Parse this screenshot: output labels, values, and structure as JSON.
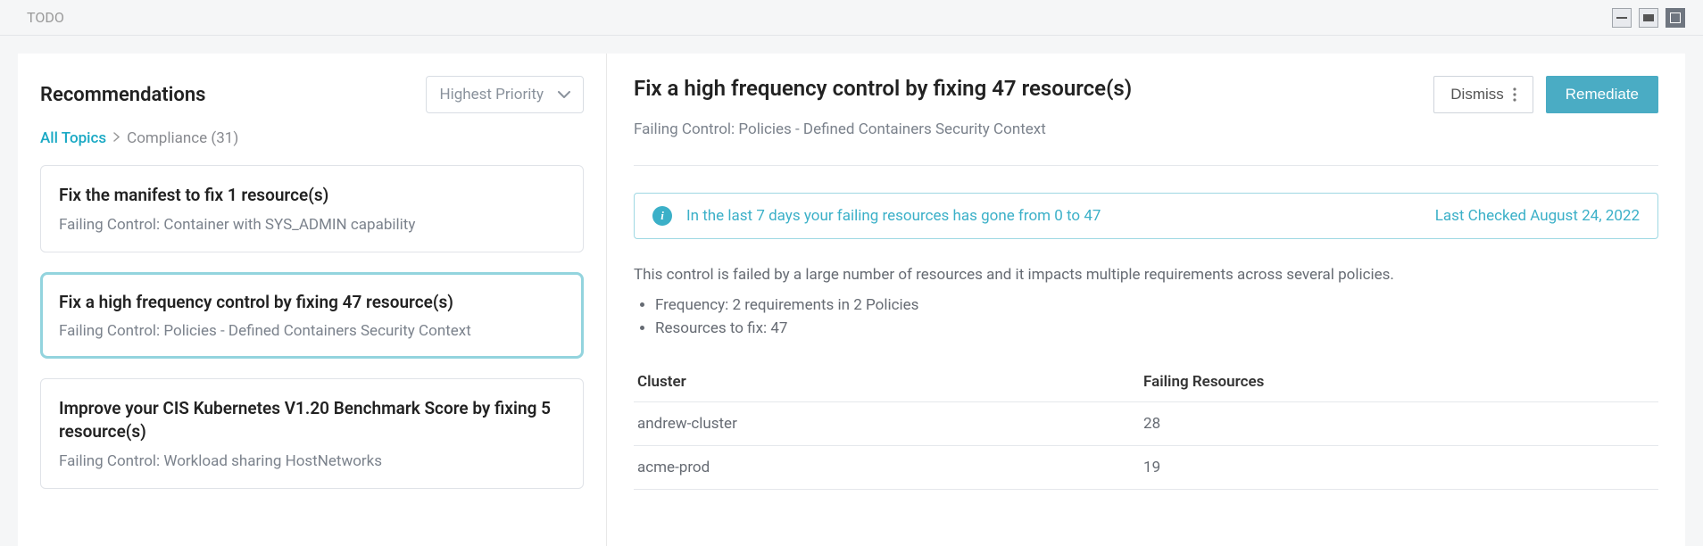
{
  "topbar": {
    "title": "TODO"
  },
  "sidebar": {
    "heading": "Recommendations",
    "sort_label": "Highest Priority",
    "breadcrumb": {
      "root": "All Topics",
      "current": "Compliance (31)"
    },
    "cards": [
      {
        "title": "Fix the manifest to fix 1 resource(s)",
        "sub": "Failing Control: Container with SYS_ADMIN capability",
        "selected": false
      },
      {
        "title": "Fix a high frequency control by fixing 47 resource(s)",
        "sub": "Failing Control: Policies - Defined Containers Security Context",
        "selected": true
      },
      {
        "title": "Improve your CIS Kubernetes V1.20 Benchmark Score by fixing 5 resource(s)",
        "sub": "Failing Control: Workload sharing HostNetworks",
        "selected": false
      }
    ]
  },
  "detail": {
    "title": "Fix a high frequency control by fixing 47 resource(s)",
    "sub": "Failing Control: Policies - Defined Containers Security Context",
    "actions": {
      "dismiss": "Dismiss",
      "remediate": "Remediate"
    },
    "notice": {
      "text": "In the last 7 days your failing resources has gone from 0 to 47",
      "checked": "Last Checked August 24, 2022"
    },
    "desc": "This control is failed by a large number of resources and it impacts multiple requirements across several policies.",
    "bullets": [
      "Frequency: 2 requirements in 2 Policies",
      "Resources to fix: 47"
    ],
    "table": {
      "headers": [
        "Cluster",
        "Failing Resources"
      ],
      "rows": [
        {
          "cluster": "andrew-cluster",
          "failing": "28"
        },
        {
          "cluster": "acme-prod",
          "failing": "19"
        }
      ]
    }
  }
}
